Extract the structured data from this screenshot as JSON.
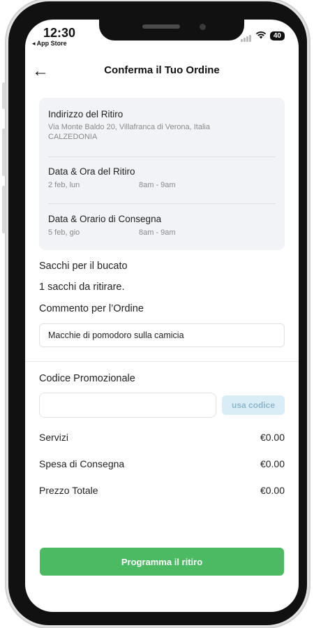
{
  "status_bar": {
    "time": "12:30",
    "back_app": "◂ App Store",
    "battery": "40"
  },
  "header": {
    "back_icon": "arrow-left-icon",
    "title": "Conferma il Tuo Ordine"
  },
  "pickup_address": {
    "title": "Indirizzo del Ritiro",
    "address": "Via Monte Baldo 20, Villafranca di Verona, Italia",
    "name": "CALZEDONIA"
  },
  "pickup_time": {
    "title": "Data & Ora del Ritiro",
    "date": "2 feb, lun",
    "slot": "8am - 9am"
  },
  "delivery_time": {
    "title": "Data & Orario di Consegna",
    "date": "5 feb, gio",
    "slot": "8am - 9am"
  },
  "bags": {
    "label": "Sacchi per il bucato",
    "value": "1 sacchi da ritirare."
  },
  "comment": {
    "label": "Commento per l’Ordine",
    "value": "Macchie di pomodoro sulla camicia"
  },
  "promo": {
    "label": "Codice Promozionale",
    "placeholder": "",
    "button": "usa codice"
  },
  "summary": [
    {
      "label": "Servizi",
      "value": "€0.00"
    },
    {
      "label": "Spesa di Consegna",
      "value": "€0.00"
    },
    {
      "label": "Prezzo Totale",
      "value": "€0.00"
    }
  ],
  "cta": {
    "label": "Programma il ritiro",
    "color": "#4cb963"
  }
}
